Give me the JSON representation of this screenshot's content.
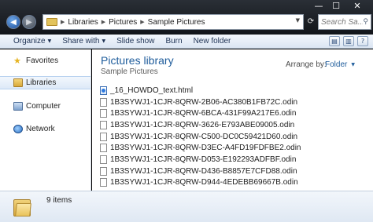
{
  "window": {
    "controls": {
      "minimize": "—",
      "maximize": "☐",
      "close": "✕"
    }
  },
  "nav": {
    "back_icon": "back-arrow-icon",
    "forward_icon": "forward-arrow-icon",
    "back_glyph": "◀",
    "forward_glyph": "▶",
    "dropdown_glyph": "▼"
  },
  "address": {
    "crumbs": [
      "Libraries",
      "Pictures",
      "Sample Pictures"
    ],
    "separator": "▶",
    "end_glyph": "▼",
    "refresh_glyph": "⟳"
  },
  "search": {
    "placeholder": "Search Sa...",
    "icon_glyph": "⚲"
  },
  "toolbar": {
    "organize": "Organize",
    "share_with": "Share with",
    "slide_show": "Slide show",
    "burn": "Burn",
    "new_folder": "New folder",
    "caret": "▼",
    "view_glyph": "▤",
    "preview_glyph": "▥",
    "help_glyph": "?"
  },
  "sidebar": {
    "items": [
      {
        "label": "Favorites",
        "icon": "star-icon",
        "glyph": "★"
      },
      {
        "label": "Libraries",
        "icon": "library-icon"
      },
      {
        "label": "Computer",
        "icon": "computer-icon"
      },
      {
        "label": "Network",
        "icon": "network-icon"
      }
    ]
  },
  "library": {
    "title": "Pictures library",
    "subtitle": "Sample Pictures",
    "arrange_label": "Arrange by:",
    "arrange_value": "Folder"
  },
  "files": [
    {
      "name": "_16_HOWDO_text.html",
      "type": "html"
    },
    {
      "name": "1B3SYWJ1-1CJR-8QRW-2B06-AC380B1FB72C.odin",
      "type": "odin"
    },
    {
      "name": "1B3SYWJ1-1CJR-8QRW-6BCA-431F99A217E6.odin",
      "type": "odin"
    },
    {
      "name": "1B3SYWJ1-1CJR-8QRW-3626-E793ABE09005.odin",
      "type": "odin"
    },
    {
      "name": "1B3SYWJ1-1CJR-8QRW-C500-DC0C59421D60.odin",
      "type": "odin"
    },
    {
      "name": "1B3SYWJ1-1CJR-8QRW-D3EC-A4FD19FDFBE2.odin",
      "type": "odin"
    },
    {
      "name": "1B3SYWJ1-1CJR-8QRW-D053-E192293ADFBF.odin",
      "type": "odin"
    },
    {
      "name": "1B3SYWJ1-1CJR-8QRW-D436-B8857E7CFD88.odin",
      "type": "odin"
    },
    {
      "name": "1B3SYWJ1-1CJR-8QRW-D944-4EDEBB69667B.odin",
      "type": "odin"
    }
  ],
  "details": {
    "item_count": "9 items"
  },
  "colors": {
    "accent_title": "#1e5c9b",
    "titlebar": "#12151a",
    "command_bar": "#dbe6f3"
  }
}
